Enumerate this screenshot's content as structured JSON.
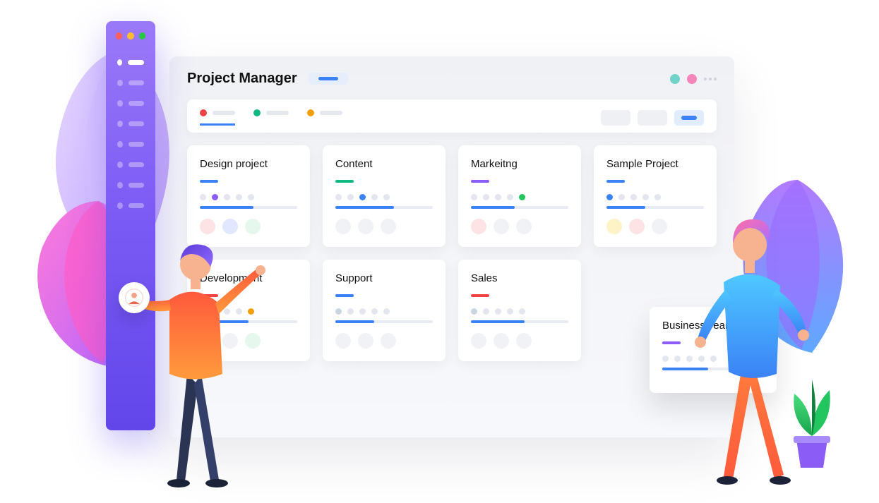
{
  "app": {
    "title": "Project Manager"
  },
  "header": {
    "avatars": [
      "#6fd3c7",
      "#f586b9"
    ]
  },
  "tabs": [
    {
      "color": "#ef4444",
      "active": true
    },
    {
      "color": "#10b981",
      "active": false
    },
    {
      "color": "#f59e0b",
      "active": false
    }
  ],
  "cards": [
    {
      "title": "Design project",
      "accent": "#3b82f6",
      "highlight_index": 1,
      "highlight_color": "#8b5cf6",
      "progress": 55,
      "chip_colors": [
        "#fde3e3",
        "#e0e7ff",
        "#e6f7ee"
      ]
    },
    {
      "title": "Content",
      "accent": "#10b981",
      "highlight_index": 2,
      "highlight_color": "#3b82f6",
      "progress": 60,
      "chip_colors": [
        "#f1f2f6",
        "#f1f2f6",
        "#f1f2f6"
      ]
    },
    {
      "title": "Markeitng",
      "accent": "#8b5cf6",
      "highlight_index": 4,
      "highlight_color": "#22c55e",
      "progress": 45,
      "chip_colors": [
        "#fde3e3",
        "#f1f2f6",
        "#f1f2f6"
      ]
    },
    {
      "title": "Sample Project",
      "accent": "#3b82f6",
      "highlight_index": 0,
      "highlight_color": "#3b82f6",
      "progress": 40,
      "chip_colors": [
        "#fef3c7",
        "#fde3e3",
        "#f1f2f6"
      ]
    },
    {
      "title": "Development",
      "accent": "#ef4444",
      "highlight_index": 4,
      "highlight_color": "#f59e0b",
      "progress": 50,
      "chip_colors": [
        "#f1f2f6",
        "#f1f2f6",
        "#e6f7ee"
      ]
    },
    {
      "title": "Support",
      "accent": "#3b82f6",
      "highlight_index": 0,
      "highlight_color": "#cbd5e1",
      "progress": 40,
      "chip_colors": [
        "#f1f2f6",
        "#f1f2f6",
        "#f1f2f6"
      ]
    },
    {
      "title": "Sales",
      "accent": "#ef4444",
      "highlight_index": 0,
      "highlight_color": "#cbd5e1",
      "progress": 55,
      "chip_colors": [
        "#f1f2f6",
        "#f1f2f6",
        "#f1f2f6"
      ]
    }
  ],
  "float_card": {
    "title": "Business Team",
    "accent": "#8b5cf6",
    "progress": 45
  },
  "sidebar": {
    "active_index": 0,
    "item_count": 8
  }
}
